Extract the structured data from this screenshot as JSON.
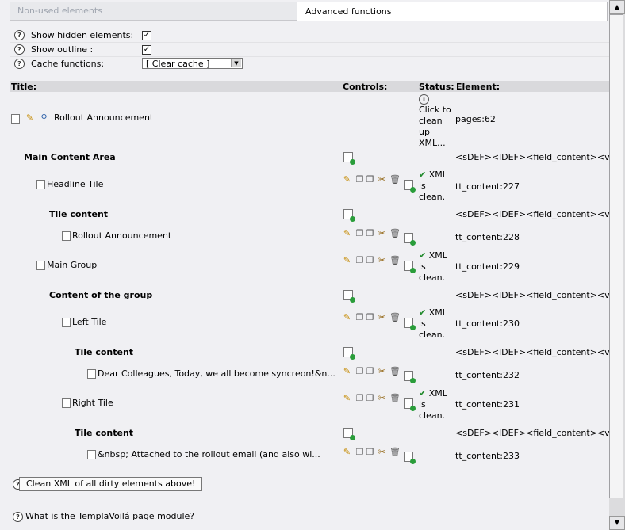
{
  "tabs": [
    {
      "label": "Non-used elements",
      "active": false
    },
    {
      "label": "Advanced functions",
      "active": true
    }
  ],
  "options": {
    "show_hidden_label": "Show hidden elements:",
    "show_hidden_checked": true,
    "show_outline_label": "Show outline :",
    "show_outline_checked": true,
    "cache_label": "Cache functions:",
    "cache_select_value": "[ Clear cache ]"
  },
  "table": {
    "headers": {
      "title": "Title:",
      "controls": "Controls:",
      "status": "Status:",
      "element": "Element:"
    }
  },
  "page_row": {
    "title": "Rollout Announcement",
    "status": "Click to clean up XML...",
    "element": "pages:62"
  },
  "rows": [
    {
      "title": "Main Content Area",
      "bold": true,
      "element": "<sDEF><lDEF><field_content><vDEF>"
    },
    {
      "title": "Headline Tile",
      "bold": false,
      "status": "XML is clean.",
      "element": "tt_content:227"
    },
    {
      "title": "Tile content",
      "bold": true,
      "element": "<sDEF><lDEF><field_content><vDEF>"
    },
    {
      "title": "Rollout Announcement",
      "bold": false,
      "element": "tt_content:228"
    },
    {
      "title": "Main Group",
      "bold": false,
      "status": "XML is clean.",
      "element": "tt_content:229"
    },
    {
      "title": "Content of the group",
      "bold": true,
      "element": "<sDEF><lDEF><field_content><vDEF>"
    },
    {
      "title": "Left Tile",
      "bold": false,
      "status": "XML is clean.",
      "element": "tt_content:230"
    },
    {
      "title": "Tile content",
      "bold": true,
      "element": "<sDEF><lDEF><field_content><vDEF>"
    },
    {
      "title": "Dear Colleagues, Today, we all become syncreon!&n...",
      "bold": false,
      "element": "tt_content:232"
    },
    {
      "title": "Right Tile",
      "bold": false,
      "status": "XML is clean.",
      "element": "tt_content:231"
    },
    {
      "title": "Tile content",
      "bold": true,
      "element": "<sDEF><lDEF><field_content><vDEF>"
    },
    {
      "title": "&nbsp; Attached to the rollout email (and also wi...",
      "bold": false,
      "element": "tt_content:233"
    }
  ],
  "clean_button": "Clean XML of all dirty elements above!",
  "footer_help": "What is the TemplaVoilá page module?",
  "icons": {
    "help": "help-circle-icon",
    "doc": "document-icon",
    "edit": "pencil-icon",
    "view": "magnifier-icon",
    "copy": "copy-icon",
    "cut": "scissors-icon",
    "delete": "trash-icon",
    "new": "new-record-icon",
    "check": "checkmark-icon",
    "info": "info-icon"
  },
  "colors": {
    "background": "#f0f0f3",
    "tab_inactive_text": "#a0a6b0",
    "check": "#218a2c"
  }
}
